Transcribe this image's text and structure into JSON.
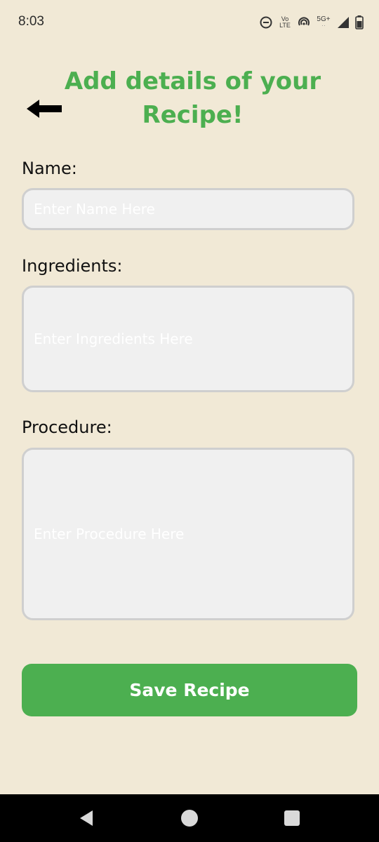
{
  "status_bar": {
    "time": "8:03",
    "volte_top": "Vo",
    "volte_bottom": "LTE",
    "network_type": "5G+"
  },
  "header": {
    "title": "Add details of your Recipe!"
  },
  "form": {
    "name_label": "Name:",
    "name_placeholder": "Enter Name Here",
    "ingredients_label": "Ingredients:",
    "ingredients_placeholder": "Enter Ingredients Here",
    "procedure_label": "Procedure:",
    "procedure_placeholder": "Enter Procedure Here"
  },
  "actions": {
    "save_label": "Save Recipe"
  },
  "theme": {
    "accent": "#4caf50",
    "background": "#f1e9d6",
    "input_bg": "#f0f0f0",
    "input_border": "#cfcfcf"
  }
}
